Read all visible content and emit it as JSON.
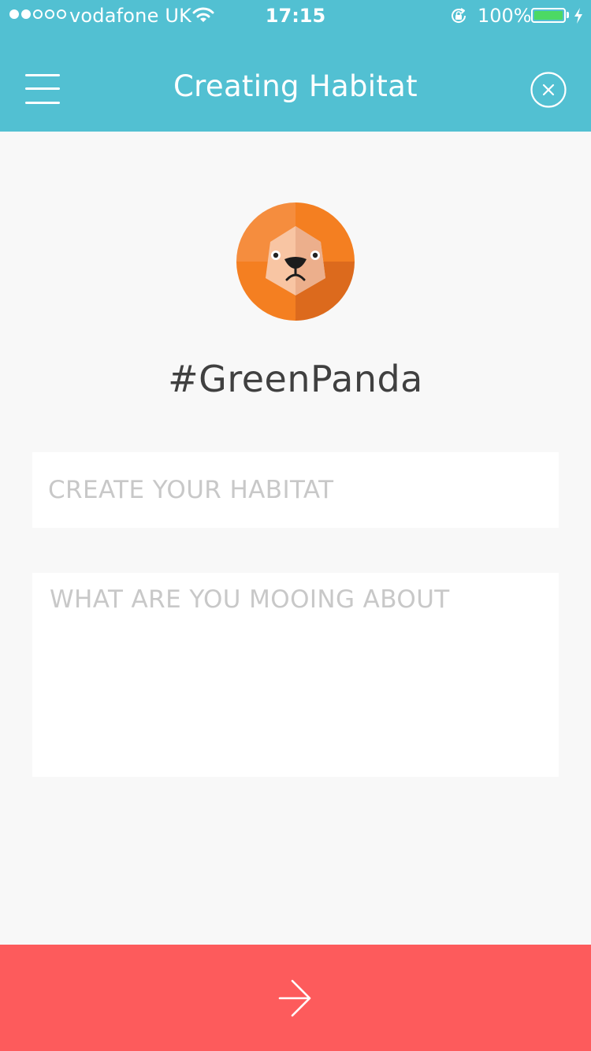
{
  "status_bar": {
    "carrier": "vodafone UK",
    "time": "17:15",
    "battery_percent": "100%",
    "signal_strength": 2,
    "signal_max": 5,
    "battery_level": 1.0,
    "battery_color": "#4cd964",
    "icons": [
      "wifi-icon",
      "orientation-lock-icon",
      "battery-icon",
      "charging-icon"
    ]
  },
  "nav": {
    "title": "Creating Habitat",
    "menu_icon": "hamburger-menu-icon",
    "close_icon": "close-circle-icon",
    "background_color": "#52c0d2"
  },
  "profile": {
    "avatar_icon": "lion-avatar-icon",
    "handle": "#GreenPanda"
  },
  "form": {
    "habitat_placeholder": "CREATE YOUR HABITAT",
    "habitat_value": "",
    "message_placeholder": "WHAT ARE YOU MOOING ABOUT",
    "message_value": ""
  },
  "footer": {
    "next_icon": "arrow-right-icon",
    "background_color": "#fd5b5c"
  }
}
